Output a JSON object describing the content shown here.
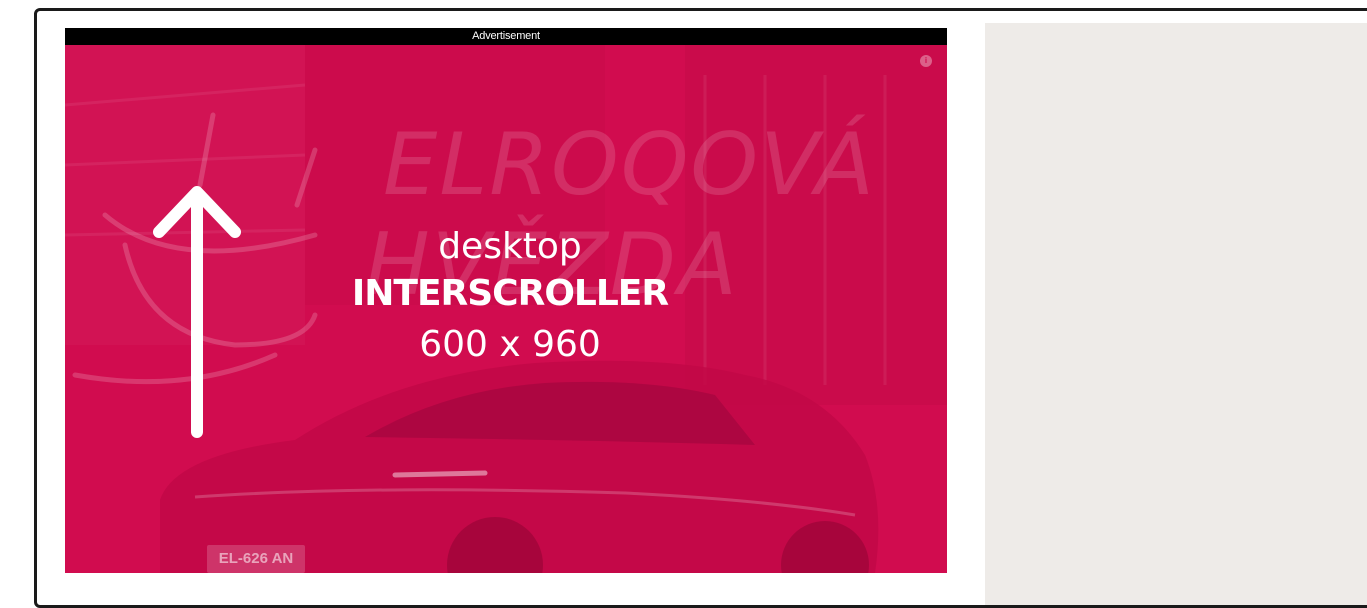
{
  "ad": {
    "label": "Advertisement",
    "creative": {
      "line1": "desktop",
      "line2": "INTERSCROLLER",
      "line3": "600 x 960",
      "background_headline_1": "ELROQOVÁ",
      "background_headline_2": "HVĚZDA",
      "plate_text": "EL-626 AN",
      "info_icon": "i"
    }
  },
  "colors": {
    "ad_background": "#d10c4f",
    "ad_label_bar": "#000000",
    "sidebar_panel": "#eeebe8",
    "frame_border": "#1a1a1a"
  },
  "icons": {
    "arrow": "arrow-up-icon",
    "info": "ad-info-icon"
  }
}
